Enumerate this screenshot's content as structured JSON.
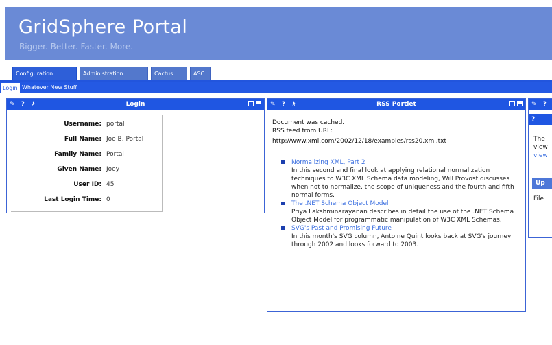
{
  "header": {
    "title": "GridSphere Portal",
    "tagline": "Bigger. Better. Faster. More."
  },
  "tabs": [
    {
      "label": "Configuration",
      "active": true
    },
    {
      "label": "Administration",
      "active": false
    },
    {
      "label": "Cactus",
      "active": false
    },
    {
      "label": "ASC",
      "active": false
    }
  ],
  "subtabs": [
    {
      "label": "Login",
      "active": true
    },
    {
      "label": "Whatever New Stuff",
      "active": false
    }
  ],
  "portlet_controls": {
    "left": "✎ ? ⚷"
  },
  "login_portlet": {
    "title": "Login",
    "fields": [
      {
        "key": "Username:",
        "value": "portal"
      },
      {
        "key": "Full Name:",
        "value": "Joe B. Portal"
      },
      {
        "key": "Family Name:",
        "value": "Portal"
      },
      {
        "key": "Given Name:",
        "value": "Joey"
      },
      {
        "key": "User ID:",
        "value": "45"
      },
      {
        "key": "Last Login Time:",
        "value": "0"
      }
    ]
  },
  "rss_portlet": {
    "title": "RSS Portlet",
    "cached_text": "Document was cached.",
    "feed_label": "RSS feed from URL:",
    "feed_url": "http://www.xml.com/2002/12/18/examples/rss20.xml.txt",
    "items": [
      {
        "title": "Normalizing XML, Part 2",
        "description": "In this second and final look at applying relational normalization techniques to W3C XML Schema data modeling, Will Provost discusses when not to normalize, the scope of uniqueness and the fourth and fifth normal forms."
      },
      {
        "title": "The .NET Schema Object Model",
        "description": "Priya Lakshminarayanan describes in detail the use of the .NET Schema Object Model for programmatic manipulation of W3C XML Schemas."
      },
      {
        "title": "SVG's Past and Promising Future",
        "description": "In this month's SVG column, Antoine Quint looks back at SVG's journey through 2002 and looks forward to 2003."
      }
    ]
  },
  "third_portlet": {
    "title_partial": "?",
    "line1": "The",
    "line2": "view",
    "link": "view",
    "button": "Up",
    "file_label": "File"
  },
  "colors": {
    "header_bg": "#6a8ad6",
    "bar_bg": "#1f56e2",
    "link": "#3b6fe0"
  }
}
